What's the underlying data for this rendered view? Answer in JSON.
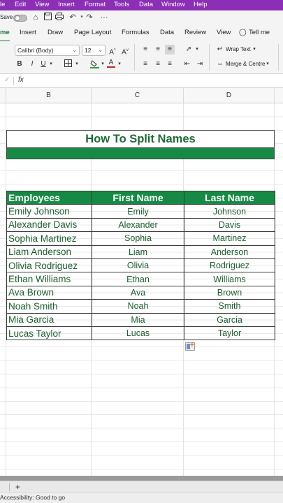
{
  "menu": [
    "le",
    "Edit",
    "View",
    "Insert",
    "Format",
    "Tools",
    "Data",
    "Window",
    "Help"
  ],
  "qat": {
    "save_label": "Save",
    "icons": [
      "home-icon",
      "save-icon",
      "print-icon",
      "undo-icon",
      "redo-icon",
      "more-icon"
    ]
  },
  "tabs": [
    "me",
    "Insert",
    "Draw",
    "Page Layout",
    "Formulas",
    "Data",
    "Review",
    "View"
  ],
  "tell_me": "Tell me",
  "ribbon": {
    "font_name": "Calibri (Body)",
    "font_size": "12",
    "wrap_text": "Wrap Text",
    "merge_center": "Merge & Centre",
    "bold": "B",
    "italic": "I",
    "underline": "U",
    "font_color_letter": "A"
  },
  "formula_bar": {
    "fx": "fx"
  },
  "columns": [
    "B",
    "C",
    "D"
  ],
  "title": "How To Split Names",
  "table": {
    "headers": [
      "Employees",
      "First Name",
      "Last Name"
    ],
    "rows": [
      [
        "Emily Johnson",
        "Emily",
        "Johnson"
      ],
      [
        "Alexander Davis",
        "Alexander",
        "Davis"
      ],
      [
        "Sophia Martinez",
        "Sophia",
        "Martinez"
      ],
      [
        "Liam Anderson",
        "Liam",
        "Anderson"
      ],
      [
        "Olivia Rodriguez",
        "Olivia",
        "Rodriguez"
      ],
      [
        "Ethan Williams",
        "Ethan",
        "Williams"
      ],
      [
        "Ava Brown",
        "Ava",
        "Brown"
      ],
      [
        "Noah Smith",
        "Noah",
        "Smith"
      ],
      [
        "Mia Garcia",
        "Mia",
        "Garcia"
      ],
      [
        "Lucas Taylor",
        "Lucas",
        "Taylor"
      ]
    ]
  },
  "status": {
    "accessibility": "Accessibility: Good to go"
  },
  "sheet_add": "+",
  "colors": {
    "accent_green": "#168a45",
    "title_green": "#1e6b34",
    "menubar_purple": "#8b2fb6"
  }
}
